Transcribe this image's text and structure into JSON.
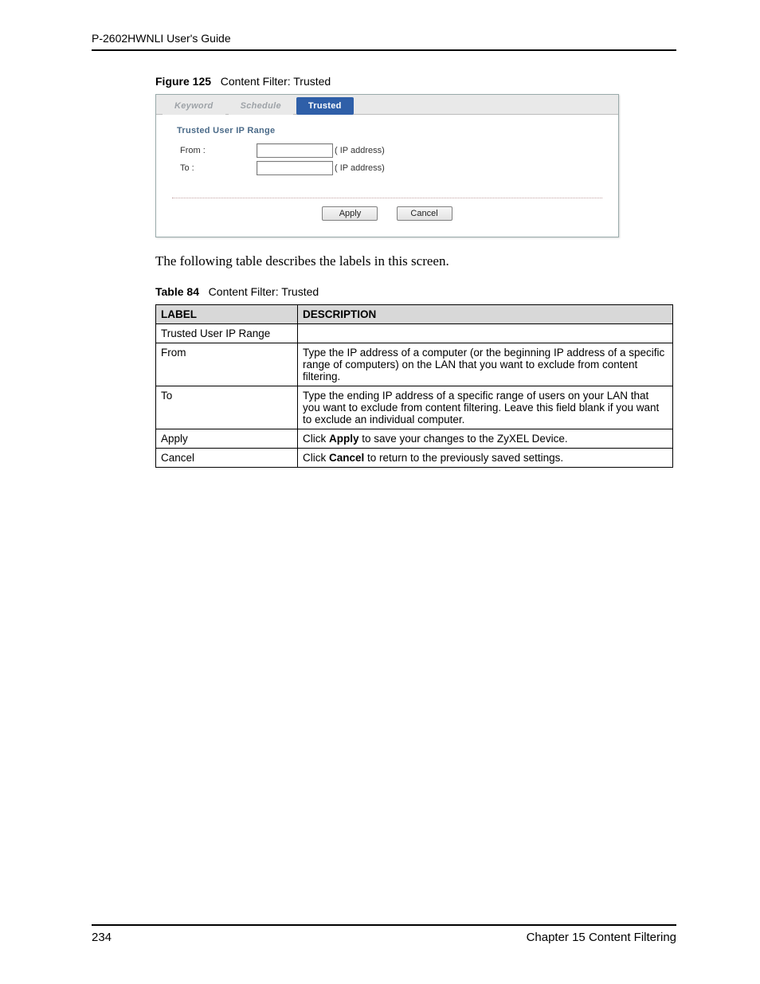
{
  "header": {
    "doc_title": "P-2602HWNLI User's Guide"
  },
  "figure": {
    "label": "Figure 125",
    "title": "Content Filter: Trusted"
  },
  "tabs": {
    "keyword": "Keyword",
    "schedule": "Schedule",
    "trusted": "Trusted"
  },
  "panel": {
    "section_title": "Trusted User IP Range",
    "from_label": "From :",
    "to_label": "To :",
    "from_value": "",
    "to_value": "",
    "ip_hint_from": "( IP address)",
    "ip_hint_to": "( IP address)",
    "apply_label": "Apply",
    "cancel_label": "Cancel"
  },
  "paragraph": "The following table describes the labels in this screen.",
  "table_caption": {
    "label": "Table 84",
    "title": "Content Filter: Trusted"
  },
  "table": {
    "head_label": "LABEL",
    "head_desc": "DESCRIPTION",
    "rows": [
      {
        "label": "Trusted User IP Range",
        "desc": ""
      },
      {
        "label": "From",
        "desc": "Type the IP address of a computer (or the beginning IP address of a specific range of computers) on the LAN that you want to exclude from content filtering."
      },
      {
        "label": "To",
        "desc": "Type the ending IP address of a specific range of users on your LAN that you want to exclude from content filtering. Leave this field blank if you want to exclude an individual computer."
      },
      {
        "label": "Apply",
        "desc_pre": "Click ",
        "desc_b": "Apply",
        "desc_post": " to save your changes to the ZyXEL Device."
      },
      {
        "label": "Cancel",
        "desc_pre": "Click ",
        "desc_b": "Cancel",
        "desc_post": " to return to the previously saved settings."
      }
    ]
  },
  "footer": {
    "page_number": "234",
    "chapter": "Chapter 15 Content Filtering"
  }
}
